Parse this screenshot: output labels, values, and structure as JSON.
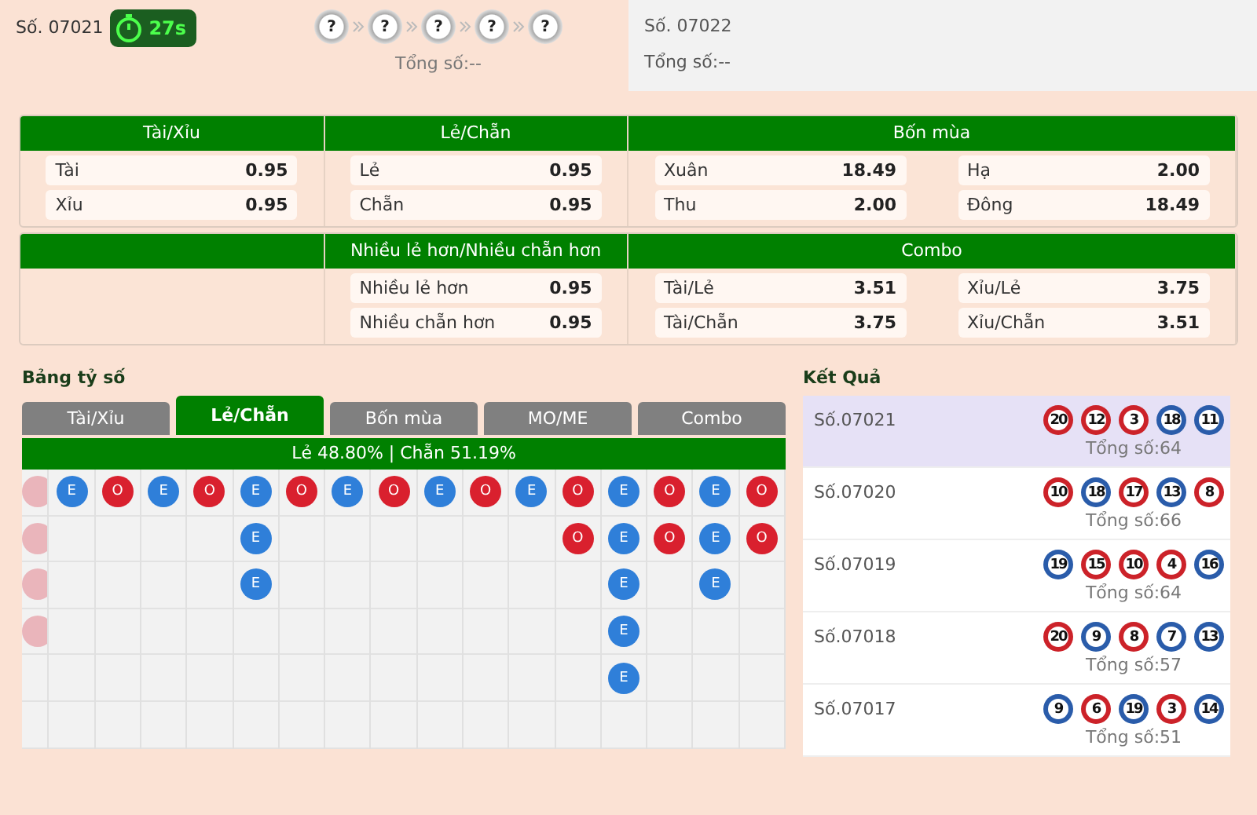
{
  "current_round": {
    "label": "Số. 07021",
    "timer": "27s",
    "balls": [
      "?",
      "?",
      "?",
      "?",
      "?"
    ],
    "total": "Tổng số:--"
  },
  "next_round": {
    "label": "Số. 07022",
    "total": "Tổng số:--"
  },
  "odds_panels": [
    {
      "sections": [
        {
          "title": "Tài/Xỉu",
          "columns": [
            [
              {
                "label": "Tài",
                "value": "0.95"
              },
              {
                "label": "Xỉu",
                "value": "0.95"
              }
            ]
          ]
        },
        {
          "title": "Lẻ/Chẵn",
          "columns": [
            [
              {
                "label": "Lẻ",
                "value": "0.95"
              },
              {
                "label": "Chẵn",
                "value": "0.95"
              }
            ]
          ]
        },
        {
          "title": "Bốn mùa",
          "columns": [
            [
              {
                "label": "Xuân",
                "value": "18.49"
              },
              {
                "label": "Thu",
                "value": "2.00"
              }
            ],
            [
              {
                "label": "Hạ",
                "value": "2.00"
              },
              {
                "label": "Đông",
                "value": "18.49"
              }
            ]
          ]
        }
      ]
    },
    {
      "sections": [
        {
          "title": "Nhiều lẻ hơn/Nhiều chẵn hơn",
          "columns": [
            [
              {
                "label": "Nhiều lẻ hơn",
                "value": "0.95"
              },
              {
                "label": "Nhiều chẵn hơn",
                "value": "0.95"
              }
            ]
          ]
        },
        {
          "title": "Combo",
          "columns": [
            [
              {
                "label": "Tài/Lẻ",
                "value": "3.51"
              },
              {
                "label": "Tài/Chẵn",
                "value": "3.75"
              }
            ],
            [
              {
                "label": "Xỉu/Lẻ",
                "value": "3.75"
              },
              {
                "label": "Xỉu/Chẵn",
                "value": "3.51"
              }
            ]
          ]
        }
      ]
    }
  ],
  "score_board": {
    "title": "Bảng tỷ số",
    "tabs": [
      {
        "label": "Tài/Xỉu",
        "selected": false
      },
      {
        "label": "Lẻ/Chẵn",
        "selected": true
      },
      {
        "label": "Bốn mùa",
        "selected": false
      },
      {
        "label": "MO/ME",
        "selected": false
      },
      {
        "label": "Combo",
        "selected": false
      }
    ],
    "summary": "Lẻ 48.80% | Chẵn 51.19%",
    "bead_columns": [
      [
        {
          "kind": "odd"
        },
        {
          "kind": "odd"
        },
        {
          "kind": "odd"
        },
        {
          "kind": "odd"
        }
      ],
      [
        {
          "kind": "even",
          "label": "E"
        }
      ],
      [
        {
          "kind": "odd",
          "label": "O"
        }
      ],
      [
        {
          "kind": "even",
          "label": "E"
        }
      ],
      [
        {
          "kind": "odd",
          "label": "O"
        }
      ],
      [
        {
          "kind": "even",
          "label": "E"
        },
        {
          "kind": "even",
          "label": "E"
        },
        {
          "kind": "even",
          "label": "E"
        }
      ],
      [
        {
          "kind": "odd",
          "label": "O"
        }
      ],
      [
        {
          "kind": "even",
          "label": "E"
        }
      ],
      [
        {
          "kind": "odd",
          "label": "O"
        }
      ],
      [
        {
          "kind": "even",
          "label": "E"
        }
      ],
      [
        {
          "kind": "odd",
          "label": "O"
        }
      ],
      [
        {
          "kind": "even",
          "label": "E"
        }
      ],
      [
        {
          "kind": "odd",
          "label": "O"
        },
        {
          "kind": "odd",
          "label": "O"
        }
      ],
      [
        {
          "kind": "even",
          "label": "E"
        },
        {
          "kind": "even",
          "label": "E"
        },
        {
          "kind": "even",
          "label": "E"
        },
        {
          "kind": "even",
          "label": "E"
        },
        {
          "kind": "even",
          "label": "E"
        }
      ],
      [
        {
          "kind": "odd",
          "label": "O"
        },
        {
          "kind": "odd",
          "label": "O"
        }
      ],
      [
        {
          "kind": "even",
          "label": "E"
        },
        {
          "kind": "even",
          "label": "E"
        },
        {
          "kind": "even",
          "label": "E"
        }
      ],
      [
        {
          "kind": "odd",
          "label": "O"
        },
        {
          "kind": "odd",
          "label": "O"
        }
      ]
    ]
  },
  "results": {
    "title": "Kết Quả",
    "rows": [
      {
        "label": "Số.07021",
        "selected": true,
        "total": "Tổng số:64",
        "balls": [
          {
            "number": "20",
            "color": "#cc2229"
          },
          {
            "number": "12",
            "color": "#cc2229"
          },
          {
            "number": "3",
            "color": "#cc2229"
          },
          {
            "number": "18",
            "color": "#2a5caa"
          },
          {
            "number": "11",
            "color": "#2a5caa"
          }
        ]
      },
      {
        "label": "Số.07020",
        "selected": false,
        "total": "Tổng số:66",
        "balls": [
          {
            "number": "10",
            "color": "#cc2229"
          },
          {
            "number": "18",
            "color": "#2a5caa"
          },
          {
            "number": "17",
            "color": "#cc2229"
          },
          {
            "number": "13",
            "color": "#2a5caa"
          },
          {
            "number": "8",
            "color": "#cc2229"
          }
        ]
      },
      {
        "label": "Số.07019",
        "selected": false,
        "total": "Tổng số:64",
        "balls": [
          {
            "number": "19",
            "color": "#2a5caa"
          },
          {
            "number": "15",
            "color": "#cc2229"
          },
          {
            "number": "10",
            "color": "#cc2229"
          },
          {
            "number": "4",
            "color": "#cc2229"
          },
          {
            "number": "16",
            "color": "#2a5caa"
          }
        ]
      },
      {
        "label": "Số.07018",
        "selected": false,
        "total": "Tổng số:57",
        "balls": [
          {
            "number": "20",
            "color": "#cc2229"
          },
          {
            "number": "9",
            "color": "#2a5caa"
          },
          {
            "number": "8",
            "color": "#cc2229"
          },
          {
            "number": "7",
            "color": "#2a5caa"
          },
          {
            "number": "13",
            "color": "#2a5caa"
          }
        ]
      },
      {
        "label": "Số.07017",
        "selected": false,
        "total": "Tổng số:51",
        "balls": [
          {
            "number": "9",
            "color": "#2a5caa"
          },
          {
            "number": "6",
            "color": "#cc2229"
          },
          {
            "number": "19",
            "color": "#2a5caa"
          },
          {
            "number": "3",
            "color": "#cc2229"
          },
          {
            "number": "14",
            "color": "#2a5caa"
          }
        ]
      }
    ]
  }
}
